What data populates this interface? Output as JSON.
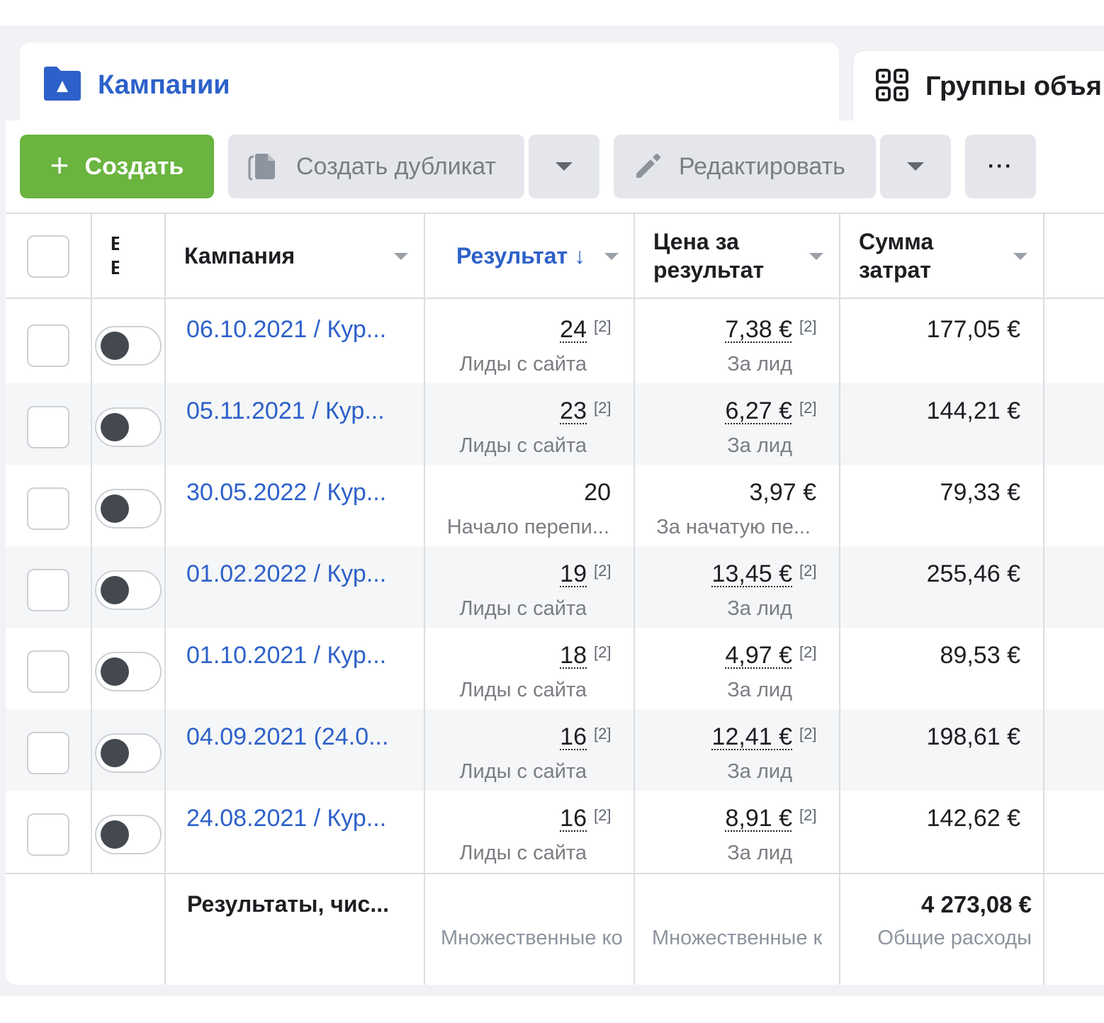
{
  "tabs": {
    "campaigns": "Кампании",
    "ad_groups": "Группы объя"
  },
  "toolbar": {
    "create": "Создать",
    "duplicate": "Создать дубликат",
    "edit": "Редактировать",
    "more": "···"
  },
  "columns": {
    "status_short": "E E",
    "campaign": "Кампания",
    "result": "Результат ↓",
    "cost_per_result_1": "Цена за",
    "cost_per_result_2": "результат",
    "spend_1": "Сумма",
    "spend_2": "затрат"
  },
  "rows": [
    {
      "name": "06.10.2021 / Кур...",
      "result": "24",
      "result_note": "[2]",
      "result_label": "Лиды с сайта",
      "cost": "7,38 €",
      "cost_note": "[2]",
      "cost_label": "За лид",
      "spend": "177,05 €",
      "striped": false,
      "on": false
    },
    {
      "name": "05.11.2021 / Кур...",
      "result": "23",
      "result_note": "[2]",
      "result_label": "Лиды с сайта",
      "cost": "6,27 €",
      "cost_note": "[2]",
      "cost_label": "За лид",
      "spend": "144,21 €",
      "striped": true,
      "on": false
    },
    {
      "name": "30.05.2022 / Кур...",
      "result": "20",
      "result_note": "",
      "result_label": "Начало перепи...",
      "cost": "3,97 €",
      "cost_note": "",
      "cost_label": "За начатую пе...",
      "spend": "79,33 €",
      "striped": false,
      "on": false
    },
    {
      "name": "01.02.2022 / Кур...",
      "result": "19",
      "result_note": "[2]",
      "result_label": "Лиды с сайта",
      "cost": "13,45 €",
      "cost_note": "[2]",
      "cost_label": "За лид",
      "spend": "255,46 €",
      "striped": true,
      "on": false
    },
    {
      "name": "01.10.2021 / Кур...",
      "result": "18",
      "result_note": "[2]",
      "result_label": "Лиды с сайта",
      "cost": "4,97 €",
      "cost_note": "[2]",
      "cost_label": "За лид",
      "spend": "89,53 €",
      "striped": false,
      "on": false
    },
    {
      "name": "04.09.2021 (24.0...",
      "result": "16",
      "result_note": "[2]",
      "result_label": "Лиды с сайта",
      "cost": "12,41 €",
      "cost_note": "[2]",
      "cost_label": "За лид",
      "spend": "198,61 €",
      "striped": true,
      "on": false
    },
    {
      "name": "24.08.2021 / Кур...",
      "result": "16",
      "result_note": "[2]",
      "result_label": "Лиды с сайта",
      "cost": "8,91 €",
      "cost_note": "[2]",
      "cost_label": "За лид",
      "spend": "142,62 €",
      "striped": false,
      "on": false
    }
  ],
  "footer": {
    "label": "Результаты, чис...",
    "result_note": "Множественные ко",
    "cost_note": "Множественные к",
    "total_spend": "4 273,08 €",
    "total_spend_label": "Общие расходы"
  },
  "colors": {
    "accent_blue": "#2d61c9",
    "create_green": "#6ab43f",
    "button_gray": "#e4e6eb"
  },
  "icons": {
    "campaigns_tab": "folder-flag-icon",
    "groups_tab": "grid-icon",
    "duplicate": "copy-icon",
    "edit": "pencil-icon"
  }
}
